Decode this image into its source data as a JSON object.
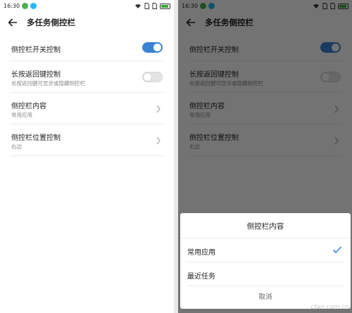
{
  "status_bar": {
    "time": "16:30"
  },
  "page": {
    "title": "多任务侧控栏"
  },
  "settings": [
    {
      "label": "侧控栏开关控制",
      "sub": "",
      "control": "toggle",
      "on": true
    },
    {
      "label": "长按返回键控制",
      "sub": "长按返回键可显示或隐藏侧控栏",
      "control": "toggle",
      "on": false
    },
    {
      "label": "侧控栏内容",
      "sub": "常用应用",
      "control": "chevron"
    },
    {
      "label": "侧控栏位置控制",
      "sub": "右边",
      "control": "chevron"
    }
  ],
  "dialog": {
    "title": "侧控栏内容",
    "options": [
      {
        "label": "常用应用",
        "selected": true
      },
      {
        "label": "最近任务",
        "selected": false
      }
    ],
    "cancel_label": "取消"
  },
  "watermark": "cfan.com.cn",
  "colors": {
    "accent": "#3b82d4",
    "overlay": "rgba(0,0,0,0.55)"
  }
}
